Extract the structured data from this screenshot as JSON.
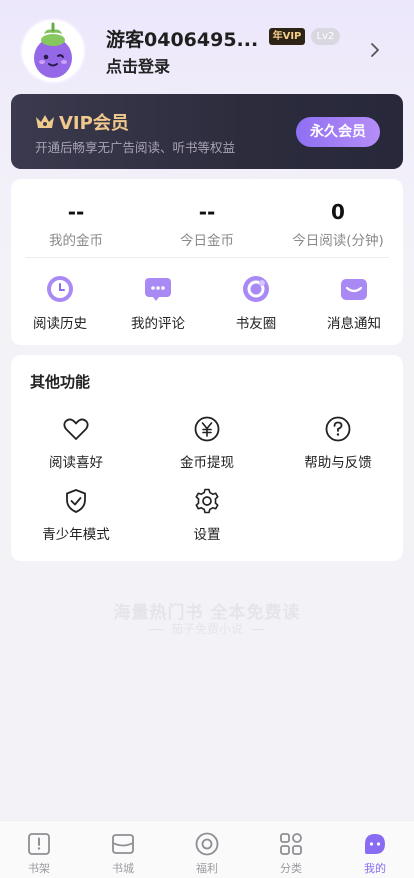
{
  "profile": {
    "username": "游客0406495...",
    "vip_badge": "年VIP",
    "level_badge": "Lv2",
    "login_tip": "点击登录"
  },
  "vip_card": {
    "title": "VIP会员",
    "description": "开通后畅享无广告阅读、听书等权益",
    "button": "永久会员",
    "accent_gold": "#f0c98c",
    "accent_purple": "#9a78f4"
  },
  "stats": [
    {
      "value": "--",
      "label": "我的金币"
    },
    {
      "value": "--",
      "label": "今日金币"
    },
    {
      "value": "0",
      "label": "今日阅读(分钟)"
    }
  ],
  "quick_actions": [
    {
      "label": "阅读历史",
      "icon": "clock-icon"
    },
    {
      "label": "我的评论",
      "icon": "comment-icon"
    },
    {
      "label": "书友圈",
      "icon": "circle-icon"
    },
    {
      "label": "消息通知",
      "icon": "mail-icon"
    }
  ],
  "other": {
    "title": "其他功能",
    "items": [
      {
        "label": "阅读喜好",
        "icon": "heart-icon"
      },
      {
        "label": "金币提现",
        "icon": "yen-coin-icon"
      },
      {
        "label": "帮助与反馈",
        "icon": "question-icon"
      },
      {
        "label": "青少年模式",
        "icon": "shield-check-icon"
      },
      {
        "label": "设置",
        "icon": "gear-icon"
      }
    ]
  },
  "slogan": {
    "main": "海量热门书 全本免费读",
    "sub": "茄子免费小说"
  },
  "nav": [
    {
      "label": "书架",
      "icon": "bookshelf-icon"
    },
    {
      "label": "书城",
      "icon": "bookstore-icon"
    },
    {
      "label": "福利",
      "icon": "welfare-icon"
    },
    {
      "label": "分类",
      "icon": "category-icon"
    },
    {
      "label": "我的",
      "icon": "profile-icon",
      "active": true
    }
  ]
}
